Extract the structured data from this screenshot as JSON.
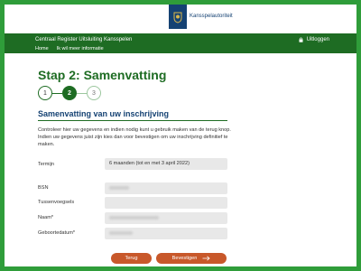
{
  "brand": {
    "logo_text": "Kansspelautoriteit"
  },
  "header": {
    "title": "Centraal Register Uitsluiting Kansspelen",
    "nav": [
      "Home",
      "Ik wil meer informatie"
    ],
    "logout_label": "Uitloggen"
  },
  "page_title": "Stap 2: Samenvatting",
  "stepper": {
    "steps": [
      "1",
      "2",
      "3"
    ],
    "active": 2
  },
  "section": {
    "title": "Samenvatting van uw inschrijving",
    "intro": "Controleer hier uw gegevens en indien nodig kunt u gebruik maken van de terug knop. Indien uw gegevens juist zijn kies dan voor bevestigen om uw inschrijving definitief te maken."
  },
  "fields": {
    "termijn": {
      "label": "Termijn",
      "value": "6 maanden (tot en met 3 april 2022)"
    },
    "bsn": {
      "label": "BSN",
      "value": ""
    },
    "tussenvoegsels": {
      "label": "Tussenvoegsels",
      "value": ""
    },
    "naam": {
      "label": "Naam*",
      "value": ""
    },
    "geboortedatum": {
      "label": "Geboortedatum*",
      "value": ""
    }
  },
  "buttons": {
    "back": "Terug",
    "confirm": "Bevestigen"
  },
  "colors": {
    "frame": "#2f9d3a",
    "header": "#1e6c23",
    "brand_blue": "#154273",
    "button": "#c8582a"
  },
  "icons": {
    "logo": "crest-icon",
    "logout": "lock-icon",
    "confirm": "arrow-right-icon"
  }
}
